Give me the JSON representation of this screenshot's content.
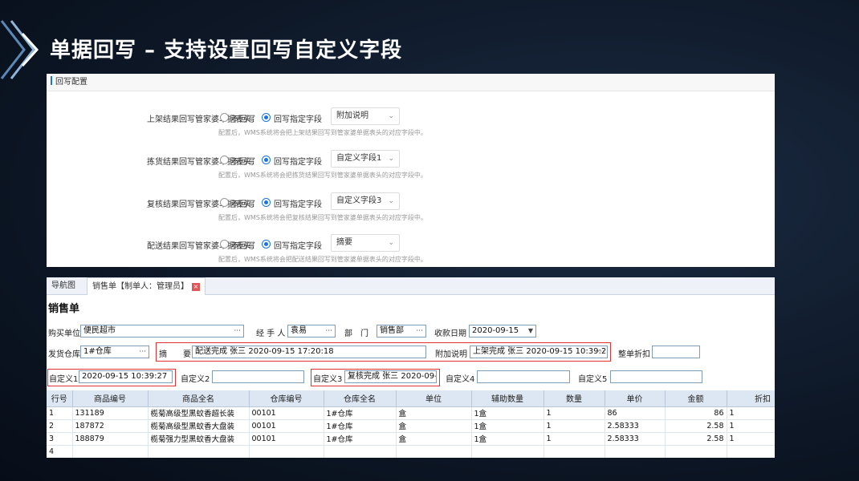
{
  "slide": {
    "title": "单据回写 – 支持设置回写自定义字段"
  },
  "config_panel": {
    "header": "回写配置",
    "rows": [
      {
        "label": "上架结果回写管家婆单据表头：",
        "opt_no": "不回写",
        "opt_yes": "回写指定字段",
        "selected_field": "附加说明",
        "hint": "配置后，WMS系统将会把上架结果回写到管家婆单据表头的对应字段中。"
      },
      {
        "label": "拣货结果回写管家婆单据表头：",
        "opt_no": "不回写",
        "opt_yes": "回写指定字段",
        "selected_field": "自定义字段1",
        "hint": "配置后，WMS系统将会把拣货结果回写到管家婆单据表头的对应字段中。"
      },
      {
        "label": "复核结果回写管家婆单据表头：",
        "opt_no": "不回写",
        "opt_yes": "回写指定字段",
        "selected_field": "自定义字段3",
        "hint": "配置后，WMS系统将会把复核结果回写到管家婆单据表头的对应字段中。"
      },
      {
        "label": "配送结果回写管家婆单据表头：",
        "opt_no": "不回写",
        "opt_yes": "回写指定字段",
        "selected_field": "摘要",
        "hint": "配置后，WMS系统将会把配送结果回写到管家婆单据表头的对应字段中。"
      }
    ]
  },
  "sales_panel": {
    "tabs": [
      "导航图",
      "销售单【制单人：管理员】"
    ],
    "form_title": "销售单",
    "fields": {
      "buyer_label": "购买单位",
      "buyer_value": "便民超市",
      "handler_label": "经 手 人",
      "handler_value": "袁易",
      "dept_label": "部　门",
      "dept_value": "销售部",
      "date_label": "收款日期",
      "date_value": "2020-09-15",
      "warehouse_label": "发货仓库",
      "warehouse_value": "1#仓库",
      "summary_label": "摘　　要",
      "summary_value": "配送完成 张三 2020-09-15 17:20:18",
      "extra_label": "附加说明",
      "extra_value": "上架完成 张三 2020-09-15 10:39:2",
      "discount_label": "整单折扣",
      "discount_value": "",
      "custom1_label": "自定义1",
      "custom1_value": "2020-09-15 10:39:27",
      "custom2_label": "自定义2",
      "custom2_value": "",
      "custom3_label": "自定义3",
      "custom3_value": "复核完成 张三 2020-09-1",
      "custom4_label": "自定义4",
      "custom4_value": "",
      "custom5_label": "自定义5",
      "custom5_value": ""
    },
    "table": {
      "columns": [
        "行号",
        "商品编号",
        "商品全名",
        "仓库编号",
        "仓库全名",
        "单位",
        "辅助数量",
        "数量",
        "单价",
        "金额",
        "折扣"
      ],
      "rows": [
        [
          "1",
          "131189",
          "榄菊高级型黑蚊香超长装",
          "00101",
          "1#仓库",
          "盒",
          "1盒",
          "1",
          "86",
          "86",
          "1"
        ],
        [
          "2",
          "187872",
          "榄菊高级型黑蚊香大盘装",
          "00101",
          "1#仓库",
          "盒",
          "1盒",
          "1",
          "2.58333",
          "2.58",
          "1"
        ],
        [
          "3",
          "188879",
          "榄菊强力型黑蚊香大盘装",
          "00101",
          "1#仓库",
          "盒",
          "1盒",
          "1",
          "2.58333",
          "2.58",
          "1"
        ],
        [
          "4",
          "",
          "",
          "",
          "",
          "",
          "",
          "",
          "",
          "",
          ""
        ]
      ]
    }
  }
}
